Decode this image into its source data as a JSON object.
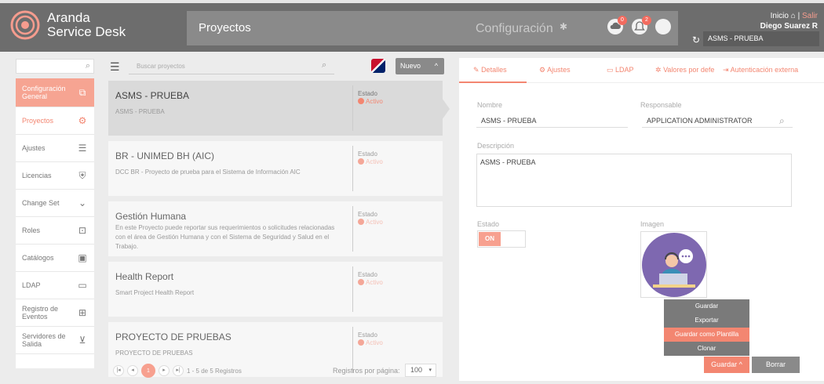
{
  "header": {
    "brand_line1": "Aranda",
    "brand_line2": "Service Desk",
    "section_title": "Proyectos",
    "config_label": "Configuración",
    "upload_badge": "0",
    "notif_badge": "2",
    "inicio_label": "Inicio",
    "separator": "|",
    "salir_label": "Salir",
    "user_name": "Diego Suarez R",
    "current_project": "ASMS - PRUEBA"
  },
  "sidebar": {
    "items": [
      {
        "label": "Configuración General",
        "icon": "copy-icon"
      },
      {
        "label": "Proyectos",
        "icon": "gear-icon"
      },
      {
        "label": "Ajustes",
        "icon": "sliders-icon"
      },
      {
        "label": "Licencias",
        "icon": "shield-icon"
      },
      {
        "label": "Change Set",
        "icon": "chevron-down-icon"
      },
      {
        "label": "Roles",
        "icon": "roles-icon"
      },
      {
        "label": "Catálogos",
        "icon": "catalog-icon"
      },
      {
        "label": "LDAP",
        "icon": "folder-icon"
      },
      {
        "label": "Registro de Eventos",
        "icon": "events-icon"
      },
      {
        "label": "Servidores de Salida",
        "icon": "download-icon"
      }
    ]
  },
  "list": {
    "search_placeholder": "Buscar proyectos",
    "new_button": "Nuevo",
    "estado_label": "Estado",
    "projects": [
      {
        "name": "ASMS - PRUEBA",
        "desc": "ASMS - PRUEBA",
        "status": "Activo"
      },
      {
        "name": "BR - UNIMED BH (AIC)",
        "desc": "DCC BR - Proyecto de prueba para el Sistema de Información AIC",
        "status": "Activo"
      },
      {
        "name": "Gestión Humana",
        "desc": "En este Proyecto puede reportar sus requerimientos o solicitudes relacionadas con el área de Gestión Humana y con el Sistema de Seguridad y Salud en el Trabajo.",
        "status": "Activo"
      },
      {
        "name": "Health Report",
        "desc": "Smart Project Health Report",
        "status": "Activo"
      },
      {
        "name": "PROYECTO DE PRUEBAS",
        "desc": "PROYECTO DE PRUEBAS",
        "status": "Activo"
      }
    ],
    "pager": {
      "first": "|◂",
      "prev": "◂",
      "current": "1",
      "next": "▸",
      "last": "▸|",
      "range": "1 - 5 de 5 Registros",
      "per_page_label": "Registros por página:",
      "per_page_value": "100"
    }
  },
  "detail": {
    "tabs": [
      "Detalles",
      "Ajustes",
      "LDAP",
      "Valores por defe",
      "Autenticación externa"
    ],
    "nombre_label": "Nombre",
    "nombre_value": "ASMS - PRUEBA",
    "responsable_label": "Responsable",
    "responsable_value": "APPLICATION ADMINISTRATOR",
    "descripcion_label": "Descripción",
    "descripcion_value": "ASMS - PRUEBA",
    "estado_label": "Estado",
    "estado_toggle": "ON",
    "imagen_label": "Imagen",
    "menu_items": [
      "Guardar",
      "Exportar",
      "Guardar como Plantilla",
      "Clonar"
    ],
    "guardar_button": "Guardar",
    "borrar_button": "Borrar"
  },
  "colors": {
    "accent": "#f38671",
    "header": "#6d6d6d"
  }
}
